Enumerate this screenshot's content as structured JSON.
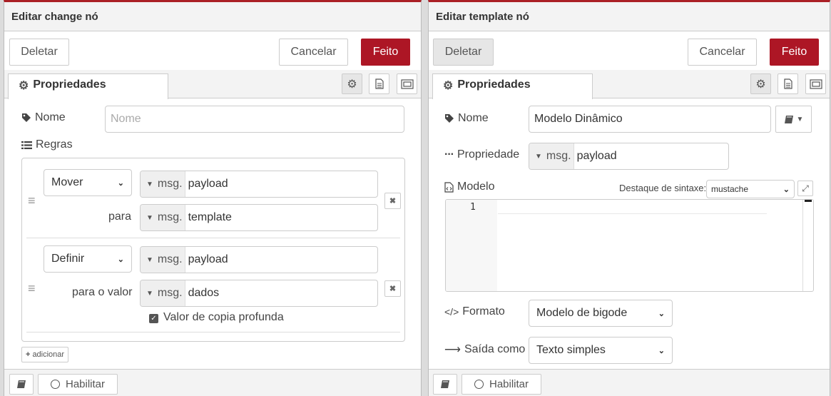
{
  "left": {
    "title": "Editar change nó",
    "delete_label": "Deletar",
    "cancel_label": "Cancelar",
    "done_label": "Feito",
    "tab_label": "Propriedades",
    "name_label": "Nome",
    "name_placeholder": "Nome",
    "rules_label": "Regras",
    "rules": [
      {
        "action": "Mover",
        "from_type": "msg.",
        "from_value": "payload",
        "to_label": "para",
        "to_type": "msg.",
        "to_value": "template"
      },
      {
        "action": "Definir",
        "from_type": "msg.",
        "from_value": "payload",
        "to_label": "para o valor",
        "to_type": "msg.",
        "to_value": "dados",
        "deep_copy_label": "Valor de copia profunda",
        "deep_copy_checked": true
      }
    ],
    "add_label": "adicionar",
    "enable_label": "Habilitar"
  },
  "right": {
    "title": "Editar template nó",
    "delete_label": "Deletar",
    "cancel_label": "Cancelar",
    "done_label": "Feito",
    "tab_label": "Propriedades",
    "name_label": "Nome",
    "name_value": "Modelo Dinâmico",
    "property_label": "Propriedade",
    "property_type": "msg.",
    "property_value": "payload",
    "template_label": "Modelo",
    "syntax_label": "Destaque de sintaxe:",
    "syntax_value": "mustache",
    "editor_line": "1",
    "format_label": "Formato",
    "format_value": "Modelo de bigode",
    "output_label": "Saída como",
    "output_value": "Texto simples",
    "enable_label": "Habilitar"
  },
  "colors": {
    "accent": "#ad1625",
    "header_bg": "#f3f3f3",
    "border": "#cccccc"
  },
  "icons": [
    "gear-icon",
    "document-icon",
    "frame-icon",
    "tag-icon",
    "list-icon",
    "drag-handle-icon",
    "close-icon",
    "plus-icon",
    "book-icon",
    "circle-icon",
    "ellipsis-icon",
    "file-code-icon",
    "code-icon",
    "arrow-right-icon",
    "expand-icon",
    "caret-down-icon"
  ]
}
